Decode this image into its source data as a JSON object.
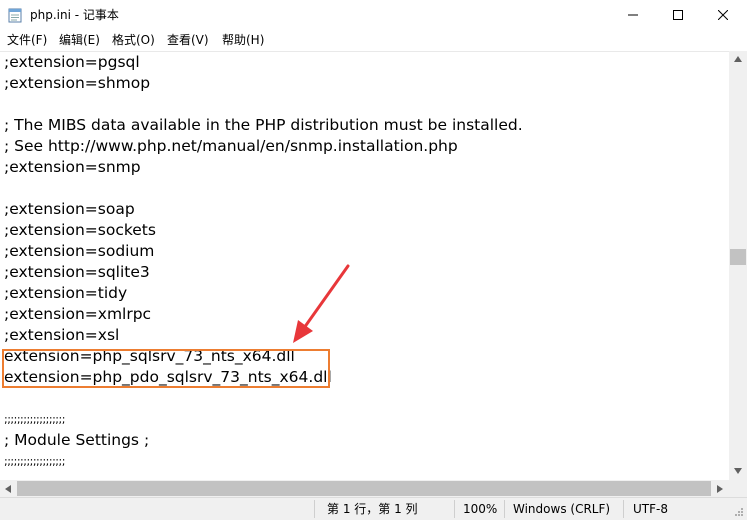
{
  "window": {
    "title": "php.ini - 记事本",
    "icons": {
      "app": "notepad-icon",
      "minimize": "minimize-icon",
      "maximize": "maximize-icon",
      "close": "close-icon"
    }
  },
  "menu": {
    "items": [
      "文件(F)",
      "编辑(E)",
      "格式(O)",
      "查看(V)",
      "帮助(H)"
    ]
  },
  "editor": {
    "lines": [
      ";extension=pgsql",
      ";extension=shmop",
      "",
      "; The MIBS data available in the PHP distribution must be installed.",
      "; See http://www.php.net/manual/en/snmp.installation.php",
      ";extension=snmp",
      "",
      ";extension=soap",
      ";extension=sockets",
      ";extension=sodium",
      ";extension=sqlite3",
      ";extension=tidy",
      ";extension=xmlrpc",
      ";extension=xsl",
      "extension=php_sqlsrv_73_nts_x64.dll",
      "extension=php_pdo_sqlsrv_73_nts_x64.dll",
      "",
      ";;;;;;;;;;;;;;;;;;;",
      "; Module Settings ;",
      ";;;;;;;;;;;;;;;;;;;"
    ]
  },
  "status": {
    "position": "第 1 行，第 1 列",
    "zoom": "100%",
    "line_ending": "Windows (CRLF)",
    "encoding": "UTF-8"
  },
  "annotation": {
    "box_color": "#ed7d31",
    "arrow_color": "#e8373a"
  }
}
